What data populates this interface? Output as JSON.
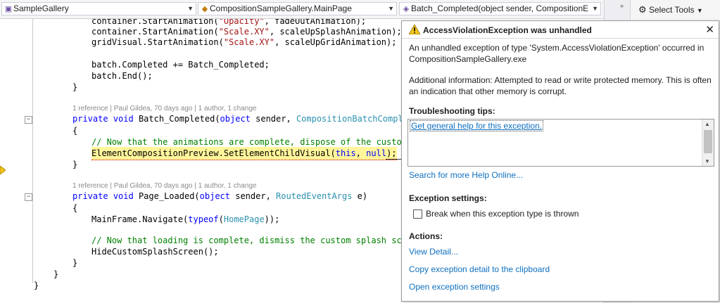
{
  "navbar": {
    "project_combo": "SampleGallery",
    "class_combo": "CompositionSampleGallery.MainPage",
    "member_combo": "Batch_Completed(object sender, CompositionE"
  },
  "right_panel": {
    "select_tools": "Select Tools"
  },
  "code": {
    "l1_a": "container.StartAnimation(",
    "l1_b": "\"Opacity\"",
    "l1_c": ", fadeOutAnimation);",
    "l2_a": "container.StartAnimation(",
    "l2_b": "\"Scale.XY\"",
    "l2_c": ", scaleUpSplashAnimation);",
    "l3_a": "gridVisual.StartAnimation(",
    "l3_b": "\"Scale.XY\"",
    "l3_c": ", scaleUpGridAnimation);",
    "l5": "batch.Completed += Batch_Completed;",
    "l6": "batch.End();",
    "brace_close": "}",
    "brace_open": "{",
    "lens1": "1 reference | Paul Gildea, 70 days ago | 1 author, 1 change",
    "l9_kw1": "private",
    "l9_kw2": "void",
    "l9_a": " Batch_Completed(",
    "l9_kw3": "object",
    "l9_b": " sender, ",
    "l9_ty": "CompositionBatchComplet",
    "l11": "// Now that the animations are complete, dispose of the custom",
    "l12_a": "ElementCompositionPreview.",
    "l12_b": "SetElementChildVisual(",
    "l12_kw": "this",
    "l12_c": ", ",
    "l12_kw2": "null",
    "l12_d": ");",
    "lens2": "1 reference | Paul Gildea, 70 days ago | 1 author, 1 change",
    "l15_kw1": "private",
    "l15_kw2": "void",
    "l15_a": " Page_Loaded(",
    "l15_kw3": "object",
    "l15_b": " sender, ",
    "l15_ty": "RoutedEventArgs",
    "l15_c": " e)",
    "l17_a": "MainFrame.Navigate(",
    "l17_kw": "typeof",
    "l17_b": "(",
    "l17_ty": "HomePage",
    "l17_c": "));",
    "l19": "// Now that loading is complete, dismiss the custom splash scre",
    "l20": "HideCustomSplashScreen();"
  },
  "exception": {
    "title": "AccessViolationException was unhandled",
    "message": "An unhandled exception of type 'System.AccessViolationException' occurred in CompositionSampleGallery.exe",
    "additional": "Additional information: Attempted to read or write protected memory. This is often an indication that other memory is corrupt.",
    "tips_heading": "Troubleshooting tips:",
    "tips_link": "Get general help for this exception.",
    "search_link": "Search for more Help Online...",
    "settings_heading": "Exception settings:",
    "break_label": "Break when this exception type is thrown",
    "break_checked": false,
    "actions_heading": "Actions:",
    "action_view": "View Detail...",
    "action_copy": "Copy exception detail to the clipboard",
    "action_open": "Open exception settings"
  },
  "colors": {
    "keyword": "#0000ff",
    "type": "#2b91af",
    "string": "#a31515",
    "comment": "#008000",
    "link": "#0e70c0",
    "highlight": "#fff59a"
  }
}
